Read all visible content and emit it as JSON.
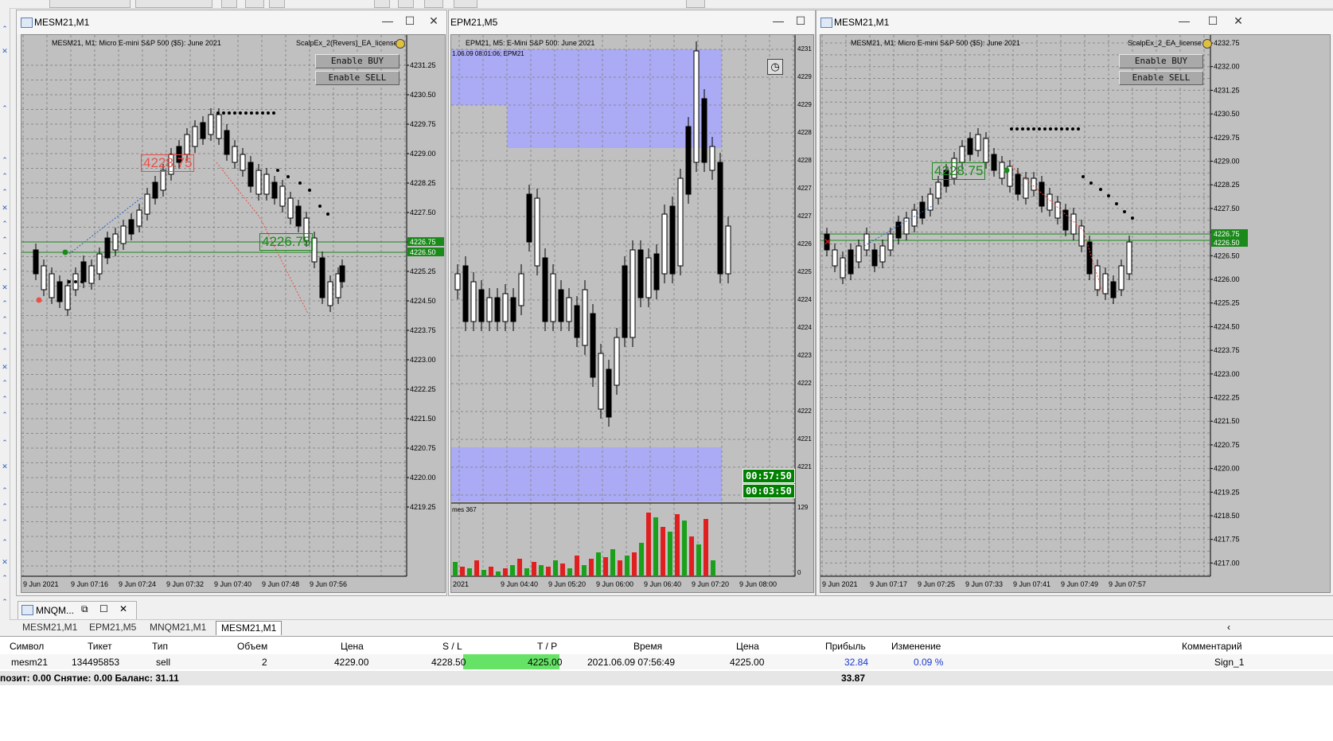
{
  "windows": [
    {
      "title": "MESM21,M1",
      "chart_header": "MESM21, M1:  Micro E-mini S&P 500 ($5): June 2021",
      "ea_name": "ScalpEx_2(Revers)_EA_license",
      "buttons": [
        "Enable  BUY",
        "Enable  SELL"
      ],
      "y_ticks": [
        "4231.25",
        "4230.50",
        "4229.75",
        "4229.00",
        "4228.25",
        "4227.50",
        "4226.00",
        "4225.25",
        "4224.50",
        "4223.75",
        "4223.00",
        "4222.25",
        "4221.50",
        "4220.75",
        "4220.00",
        "4219.25"
      ],
      "price_tags": [
        "4226.75",
        "4226.50"
      ],
      "labels": [
        "4228.75",
        "4226.75",
        "4226.50"
      ],
      "x_ticks": [
        "9 Jun 2021",
        "9 Jun 07:16",
        "9 Jun 07:24",
        "9 Jun 07:32",
        "9 Jun 07:40",
        "9 Jun 07:48",
        "9 Jun 07:56"
      ]
    },
    {
      "title": "EPM21,M5",
      "chart_header": "EPM21, M5:  E-Mini S&P 500: June 2021",
      "sub_header": "1.06.09 08:01:06; EPM21",
      "y_ticks": [
        "4231",
        "4229",
        "4229",
        "4228",
        "4228",
        "4227",
        "4227",
        "4226",
        "4225",
        "4224",
        "4224",
        "4223",
        "4222",
        "4222",
        "4221",
        "4221"
      ],
      "timers": [
        "00:57:50",
        "00:03:50"
      ],
      "volume_label": "mes 367",
      "volume_ticks": [
        "129",
        "0"
      ],
      "x_ticks": [
        "2021",
        "9 Jun 04:40",
        "9 Jun 05:20",
        "9 Jun 06:00",
        "9 Jun 06:40",
        "9 Jun 07:20",
        "9 Jun 08:00"
      ]
    },
    {
      "title": "MESM21,M1",
      "chart_header": "MESM21, M1:  Micro E-mini S&P 500 ($5): June 2021",
      "ea_name": "ScalpEx_2_EA_license",
      "buttons": [
        "Enable  BUY",
        "Enable  SELL"
      ],
      "y_ticks": [
        "4232.75",
        "4232.00",
        "4231.25",
        "4230.50",
        "4229.75",
        "4229.00",
        "4228.25",
        "4227.50",
        "4226.75",
        "4226.50",
        "4226.00",
        "4225.25",
        "4224.50",
        "4223.75",
        "4223.00",
        "4222.25",
        "4221.50",
        "4220.75",
        "4220.00",
        "4219.25",
        "4218.50",
        "4217.75",
        "4217.00"
      ],
      "price_tags": [
        "4226.75",
        "4226.50"
      ],
      "labels": [
        "4228.75"
      ],
      "x_ticks": [
        "9 Jun 2021",
        "9 Jun 07:17",
        "9 Jun 07:25",
        "9 Jun 07:33",
        "9 Jun 07:41",
        "9 Jun 07:49",
        "9 Jun 07:57"
      ]
    }
  ],
  "minimized": {
    "title": "MNQM..."
  },
  "tabs": [
    "MESM21,M1",
    "EPM21,M5",
    "MNQM21,M1",
    "MESM21,M1"
  ],
  "active_tab": 3,
  "terminal": {
    "headers": [
      "Символ",
      "Тикет",
      "Тип",
      "Объем",
      "Цена",
      "S / L",
      "T / P",
      "Время",
      "Цена",
      "Прибыль",
      "Изменение",
      "Комментарий"
    ],
    "row": [
      "mesm21",
      "134495853",
      "sell",
      "2",
      "4229.00",
      "4228.50",
      "4225.00",
      "2021.06.09 07:56:49",
      "4225.00",
      "32.84",
      "0.09 %",
      "Sign_1"
    ],
    "summary": "позит: 0.00  Снятие: 0.00  Баланс: 31.11",
    "summary_total": "33.87"
  },
  "colors": {
    "chart_bg": "#c0c0c0",
    "tp_highlight": "#66e266",
    "profit_blue": "#1a3ad0",
    "timer_green": "#008000",
    "zone_blue": "#aaaaf5"
  }
}
